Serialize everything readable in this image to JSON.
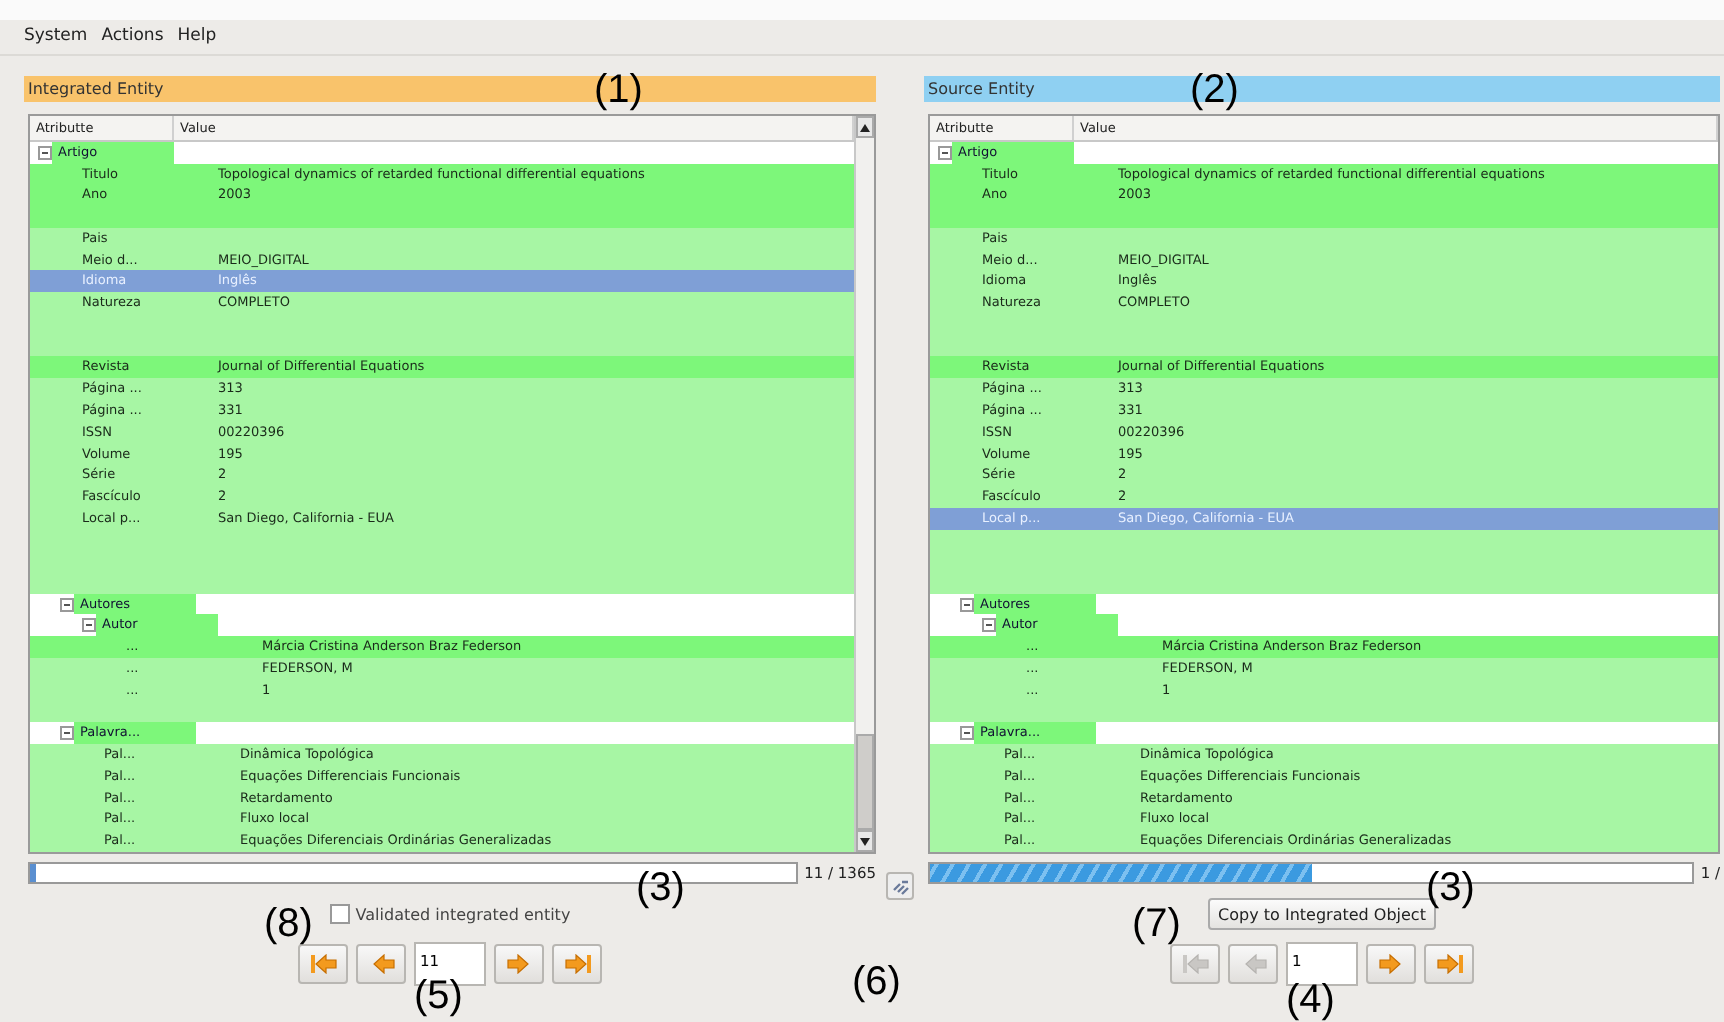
{
  "menu": [
    "System",
    "Actions",
    "Help"
  ],
  "panels": [
    {
      "title": "Integrated Entity",
      "color": "#f9c36b",
      "columns": [
        "Atributte",
        "Value"
      ],
      "scrollbar": true,
      "tree": [
        {
          "kind": "group",
          "attribute": "Artigo",
          "expanded": true,
          "children": [
            {
              "kind": "leaf",
              "attribute": "Titulo",
              "value": "Topological dynamics of retarded functional differential equations",
              "highlight": true,
              "selected": false
            },
            {
              "kind": "leaf",
              "attribute": "Ano",
              "value": "2003",
              "highlight": true,
              "selected": false
            },
            {
              "kind": "blank",
              "highlight": true,
              "selected": false
            },
            {
              "kind": "leaf",
              "attribute": "Pais",
              "highlight": false,
              "selected": false
            },
            {
              "kind": "leaf",
              "attribute": "Meio d...",
              "value": "MEIO_DIGITAL",
              "highlight": false,
              "selected": false
            },
            {
              "kind": "leaf",
              "attribute": "Idioma",
              "value": "Inglês",
              "selected": true
            },
            {
              "kind": "leaf",
              "attribute": "Natureza",
              "value": "COMPLETO",
              "highlight": false,
              "selected": false
            },
            {
              "kind": "blank",
              "highlight": false,
              "selected": false
            },
            {
              "kind": "blank",
              "highlight": false,
              "selected": false
            },
            {
              "kind": "leaf",
              "attribute": "Revista",
              "value": "Journal of Differential Equations",
              "highlight": true,
              "selected": false
            },
            {
              "kind": "leaf",
              "attribute": "Página ...",
              "value": "313",
              "highlight": false,
              "selected": false
            },
            {
              "kind": "leaf",
              "attribute": "Página ...",
              "value": "331",
              "highlight": false,
              "selected": false
            },
            {
              "kind": "leaf",
              "attribute": "ISSN",
              "value": "00220396",
              "highlight": false,
              "selected": false
            },
            {
              "kind": "leaf",
              "attribute": "Volume",
              "value": "195",
              "highlight": false,
              "selected": false
            },
            {
              "kind": "leaf",
              "attribute": "Série",
              "value": "2",
              "highlight": false,
              "selected": false
            },
            {
              "kind": "leaf",
              "attribute": "Fascículo",
              "value": "2",
              "highlight": false,
              "selected": false
            },
            {
              "kind": "leaf",
              "attribute": "Local p...",
              "value": "San Diego, California - EUA",
              "highlight": false,
              "selected": false
            },
            {
              "kind": "blank",
              "highlight": false,
              "selected": false
            },
            {
              "kind": "blank",
              "highlight": false,
              "selected": false
            },
            {
              "kind": "blank",
              "highlight": false,
              "selected": false
            },
            {
              "kind": "group",
              "attribute": "Autores",
              "expanded": true,
              "children": [
                {
                  "kind": "group",
                  "attribute": "Autor",
                  "expanded": true,
                  "children": [
                    {
                      "kind": "leaf",
                      "attribute": "...",
                      "value": "Márcia Cristina Anderson Braz Federson",
                      "highlight": true,
                      "selected": false
                    },
                    {
                      "kind": "leaf",
                      "attribute": "...",
                      "value": "FEDERSON, M",
                      "highlight": false,
                      "selected": false
                    },
                    {
                      "kind": "leaf",
                      "attribute": "...",
                      "value": "1",
                      "highlight": false,
                      "selected": false
                    }
                  ]
                },
                {
                  "kind": "blank",
                  "highlight": false,
                  "selected": false
                }
              ]
            },
            {
              "kind": "group",
              "attribute": "Palavra...",
              "expanded": true,
              "children": [
                {
                  "kind": "leaf",
                  "attribute": "Pal...",
                  "value": "Dinâmica Topológica",
                  "highlight": false,
                  "selected": false
                },
                {
                  "kind": "leaf",
                  "attribute": "Pal...",
                  "value": "Equações Differenciais Funcionais",
                  "highlight": false,
                  "selected": false
                },
                {
                  "kind": "leaf",
                  "attribute": "Pal...",
                  "value": "Retardamento",
                  "highlight": false,
                  "selected": false
                },
                {
                  "kind": "leaf",
                  "attribute": "Pal...",
                  "value": "Fluxo local",
                  "highlight": false,
                  "selected": false
                },
                {
                  "kind": "leaf",
                  "attribute": "Pal...",
                  "value": "Equações Diferenciais Ordinárias Generalizadas",
                  "highlight": false,
                  "selected": false
                }
              ]
            }
          ]
        }
      ],
      "progress": {
        "kind": "plain",
        "level": 0.008,
        "reading": "11 / 1365"
      },
      "checkbox": {
        "label": "Validated integrated entity",
        "checked": false
      },
      "nav": {
        "page": "11",
        "buttons": [
          {
            "kind": "first",
            "disabled": false
          },
          {
            "kind": "prev",
            "disabled": false
          },
          {
            "kind": "next",
            "disabled": false
          },
          {
            "kind": "last",
            "disabled": false
          }
        ]
      }
    },
    {
      "title": "Source Entity",
      "color": "#8fd0f2",
      "columns": [
        "Atributte",
        "Value"
      ],
      "tree": [
        {
          "kind": "group",
          "attribute": "Artigo",
          "expanded": true,
          "children": [
            {
              "kind": "leaf",
              "attribute": "Titulo",
              "value": "Topological dynamics of retarded functional differential equations",
              "highlight": true,
              "selected": false
            },
            {
              "kind": "leaf",
              "attribute": "Ano",
              "value": "2003",
              "highlight": true,
              "selected": false
            },
            {
              "kind": "blank",
              "highlight": true,
              "selected": false
            },
            {
              "kind": "leaf",
              "attribute": "Pais",
              "highlight": false,
              "selected": false
            },
            {
              "kind": "leaf",
              "attribute": "Meio d...",
              "value": "MEIO_DIGITAL",
              "highlight": false,
              "selected": false
            },
            {
              "kind": "leaf",
              "attribute": "Idioma",
              "value": "Inglês",
              "highlight": false,
              "selected": false
            },
            {
              "kind": "leaf",
              "attribute": "Natureza",
              "value": "COMPLETO",
              "highlight": false,
              "selected": false
            },
            {
              "kind": "blank",
              "highlight": false,
              "selected": false
            },
            {
              "kind": "blank",
              "highlight": false,
              "selected": false
            },
            {
              "kind": "leaf",
              "attribute": "Revista",
              "value": "Journal of Differential Equations",
              "highlight": true,
              "selected": false
            },
            {
              "kind": "leaf",
              "attribute": "Página ...",
              "value": "313",
              "highlight": false,
              "selected": false
            },
            {
              "kind": "leaf",
              "attribute": "Página ...",
              "value": "331",
              "highlight": false,
              "selected": false
            },
            {
              "kind": "leaf",
              "attribute": "ISSN",
              "value": "00220396",
              "highlight": false,
              "selected": false
            },
            {
              "kind": "leaf",
              "attribute": "Volume",
              "value": "195",
              "highlight": false,
              "selected": false
            },
            {
              "kind": "leaf",
              "attribute": "Série",
              "value": "2",
              "highlight": false,
              "selected": false
            },
            {
              "kind": "leaf",
              "attribute": "Fascículo",
              "value": "2",
              "highlight": false,
              "selected": false
            },
            {
              "kind": "leaf",
              "attribute": "Local p...",
              "value": "San Diego, California - EUA",
              "selected": true
            },
            {
              "kind": "blank",
              "highlight": false,
              "selected": false
            },
            {
              "kind": "blank",
              "highlight": false,
              "selected": false
            },
            {
              "kind": "blank",
              "highlight": false,
              "selected": false
            },
            {
              "kind": "group",
              "attribute": "Autores",
              "expanded": true,
              "children": [
                {
                  "kind": "group",
                  "attribute": "Autor",
                  "expanded": true,
                  "children": [
                    {
                      "kind": "leaf",
                      "attribute": "...",
                      "value": "Márcia Cristina Anderson Braz Federson",
                      "highlight": true,
                      "selected": false
                    },
                    {
                      "kind": "leaf",
                      "attribute": "...",
                      "value": "FEDERSON, M",
                      "highlight": false,
                      "selected": false
                    },
                    {
                      "kind": "leaf",
                      "attribute": "...",
                      "value": "1",
                      "highlight": false,
                      "selected": false
                    }
                  ]
                },
                {
                  "kind": "blank",
                  "highlight": false,
                  "selected": false
                }
              ]
            },
            {
              "kind": "group",
              "attribute": "Palavra...",
              "expanded": true,
              "children": [
                {
                  "kind": "leaf",
                  "attribute": "Pal...",
                  "value": "Dinâmica Topológica",
                  "highlight": false,
                  "selected": false
                },
                {
                  "kind": "leaf",
                  "attribute": "Pal...",
                  "value": "Equações Differenciais Funcionais",
                  "highlight": false,
                  "selected": false
                },
                {
                  "kind": "leaf",
                  "attribute": "Pal...",
                  "value": "Retardamento",
                  "highlight": false,
                  "selected": false
                },
                {
                  "kind": "leaf",
                  "attribute": "Pal...",
                  "value": "Fluxo local",
                  "highlight": false,
                  "selected": false
                },
                {
                  "kind": "leaf",
                  "attribute": "Pal...",
                  "value": "Equações Diferenciais Ordinárias Generalizadas",
                  "highlight": false,
                  "selected": false
                }
              ]
            }
          ]
        }
      ],
      "progress": {
        "kind": "striped",
        "level": 0.5,
        "reading": "1 /"
      },
      "button": {
        "label": "Copy to Integrated Object"
      },
      "nav": {
        "page": "1",
        "buttons": [
          {
            "kind": "first",
            "disabled": true
          },
          {
            "kind": "prev",
            "disabled": true
          },
          {
            "kind": "next",
            "disabled": false
          },
          {
            "kind": "last",
            "disabled": false
          }
        ]
      }
    }
  ],
  "annotations": [
    "(1)",
    "(2)",
    "(3)",
    "(3)",
    "(8)",
    "(7)",
    "(5)",
    "(6)",
    "(4)"
  ]
}
